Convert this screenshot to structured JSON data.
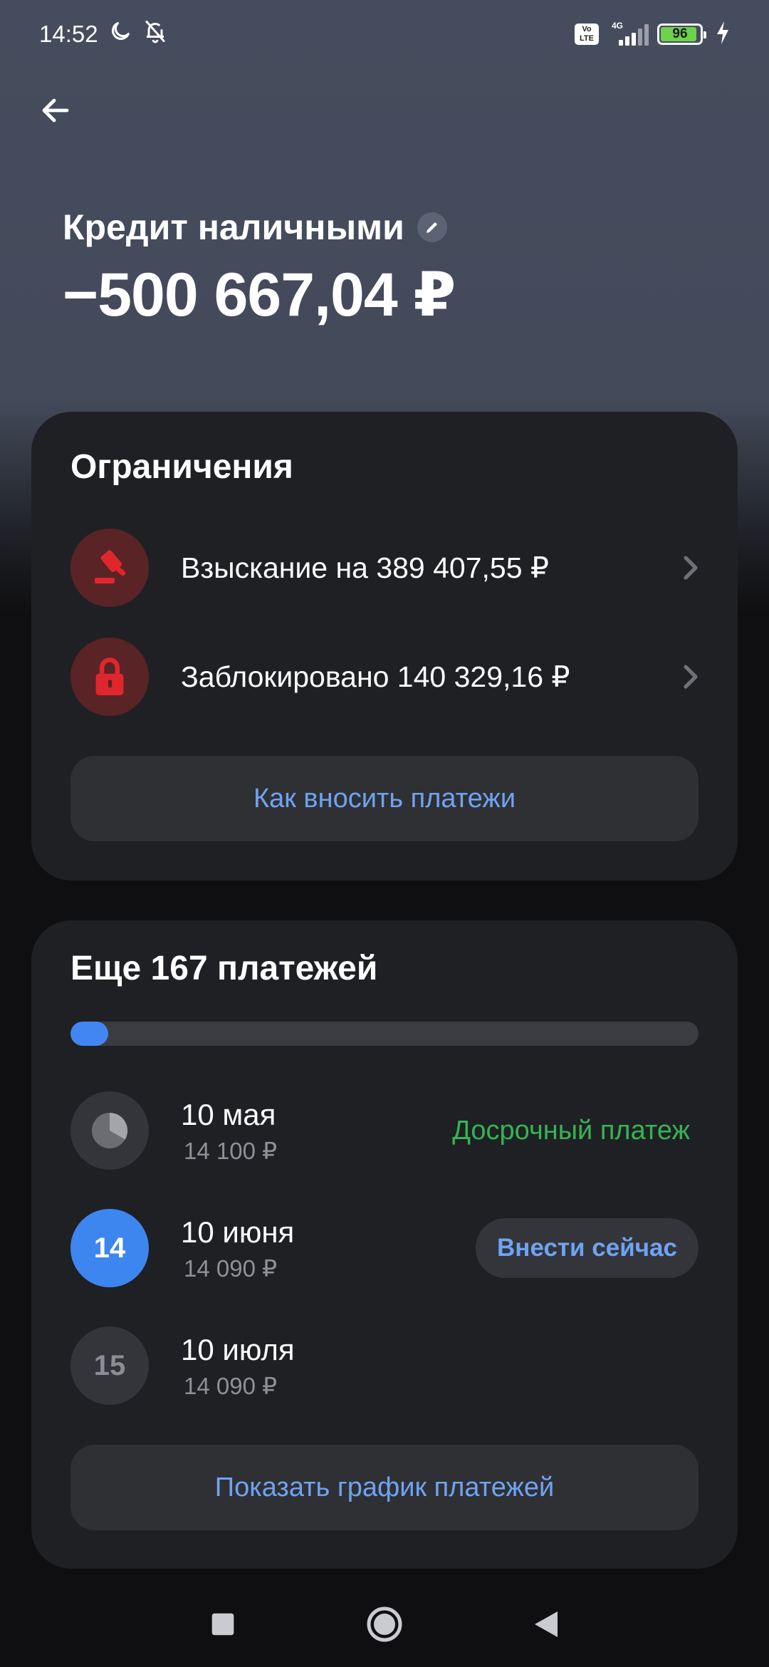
{
  "status_bar": {
    "time": "14:52",
    "network_type": "4G",
    "volte_label": "Vo LTE",
    "battery_level": "96",
    "icons": [
      "moon-icon",
      "bell-off-icon",
      "signal-icon",
      "battery-icon",
      "charging-icon"
    ]
  },
  "header": {
    "account_name": "Кредит наличными",
    "balance": "−500 667,04 ₽"
  },
  "restrictions": {
    "title": "Ограничения",
    "items": [
      {
        "label": "Взыскание на 389 407,55 ₽",
        "icon": "gavel-icon"
      },
      {
        "label": "Заблокировано 140 329,16 ₽",
        "icon": "lock-icon"
      }
    ],
    "button_label": "Как вносить платежи"
  },
  "payments": {
    "title": "Еще 167 платежей",
    "progress_fraction": 0.06,
    "items": [
      {
        "date": "10 мая",
        "amount": "14 100 ₽",
        "badge": "",
        "action": "Досрочный платеж"
      },
      {
        "date": "10 июня",
        "amount": "14 090 ₽",
        "badge": "14",
        "action": "Внести сейчас"
      },
      {
        "date": "10 июля",
        "amount": "14 090 ₽",
        "badge": "15",
        "action": ""
      }
    ],
    "schedule_button_label": "Показать график платежей"
  },
  "colors": {
    "accent_blue": "#4186f2",
    "link_blue": "#6fa3f2",
    "success_green": "#34b454",
    "danger_red": "#e0262d",
    "card_bg": "#1f2024"
  }
}
